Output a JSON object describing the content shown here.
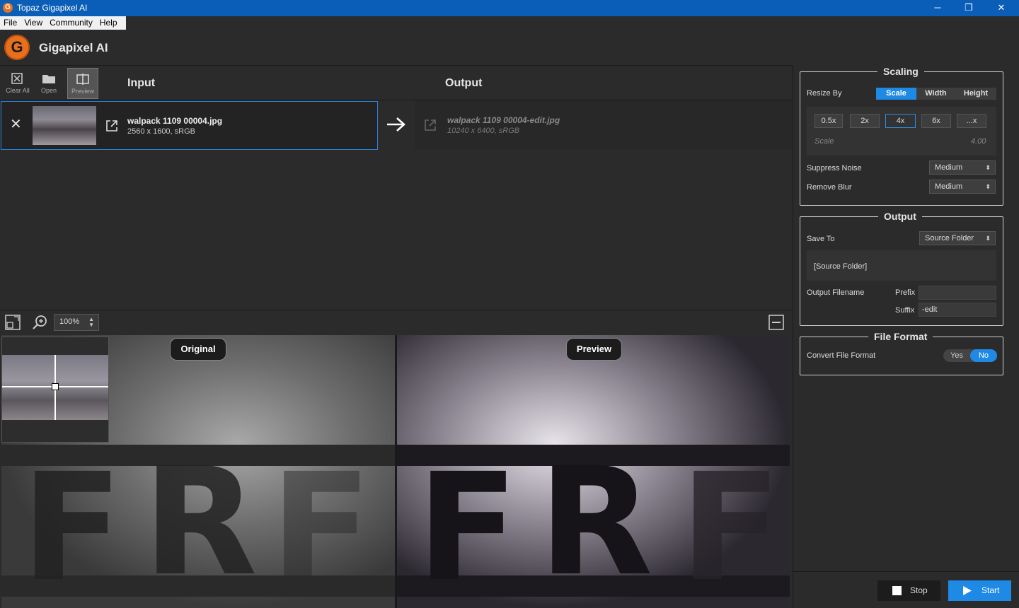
{
  "window": {
    "title": "Topaz Gigapixel AI",
    "icon": "gigapixel-app-icon",
    "minimize": "─",
    "restore": "❐",
    "close": "✕"
  },
  "menu": [
    "File",
    "View",
    "Community",
    "Help"
  ],
  "app": {
    "name": "Gigapixel AI",
    "logo_letter": "G"
  },
  "toolbar": {
    "clear_all": "Clear All",
    "open": "Open",
    "preview": "Preview"
  },
  "headers": {
    "input": "Input",
    "output": "Output"
  },
  "input_file": {
    "name": "walpack 1109 00004.jpg",
    "meta": "2560 x 1600, sRGB"
  },
  "output_file": {
    "name": "walpack 1109 00004-edit.jpg",
    "meta": "10240 x 6400, sRGB"
  },
  "viewer": {
    "zoom": "100%",
    "original_label": "Original",
    "preview_label": "Preview"
  },
  "scaling": {
    "title": "Scaling",
    "resize_by_label": "Resize By",
    "resize_by_options": [
      "Scale",
      "Width",
      "Height"
    ],
    "resize_by_selected": "Scale",
    "scale_buttons": [
      "0.5x",
      "2x",
      "4x",
      "6x",
      "...x"
    ],
    "scale_selected": "4x",
    "scale_label": "Scale",
    "scale_value": "4.00",
    "suppress_noise_label": "Suppress Noise",
    "suppress_noise_value": "Medium",
    "remove_blur_label": "Remove Blur",
    "remove_blur_value": "Medium"
  },
  "output": {
    "title": "Output",
    "save_to_label": "Save To",
    "save_to_value": "Source Folder",
    "folder_path": "[Source Folder]",
    "filename_label": "Output Filename",
    "prefix_label": "Prefix",
    "prefix_value": "",
    "suffix_label": "Suffix",
    "suffix_value": "-edit"
  },
  "file_format": {
    "title": "File Format",
    "convert_label": "Convert File Format",
    "yes": "Yes",
    "no": "No",
    "selected": "No"
  },
  "actions": {
    "stop": "Stop",
    "start": "Start"
  },
  "colors": {
    "accent": "#1f8ae6",
    "titlebar": "#0b5eb8",
    "brand_orange": "#e8701d"
  }
}
